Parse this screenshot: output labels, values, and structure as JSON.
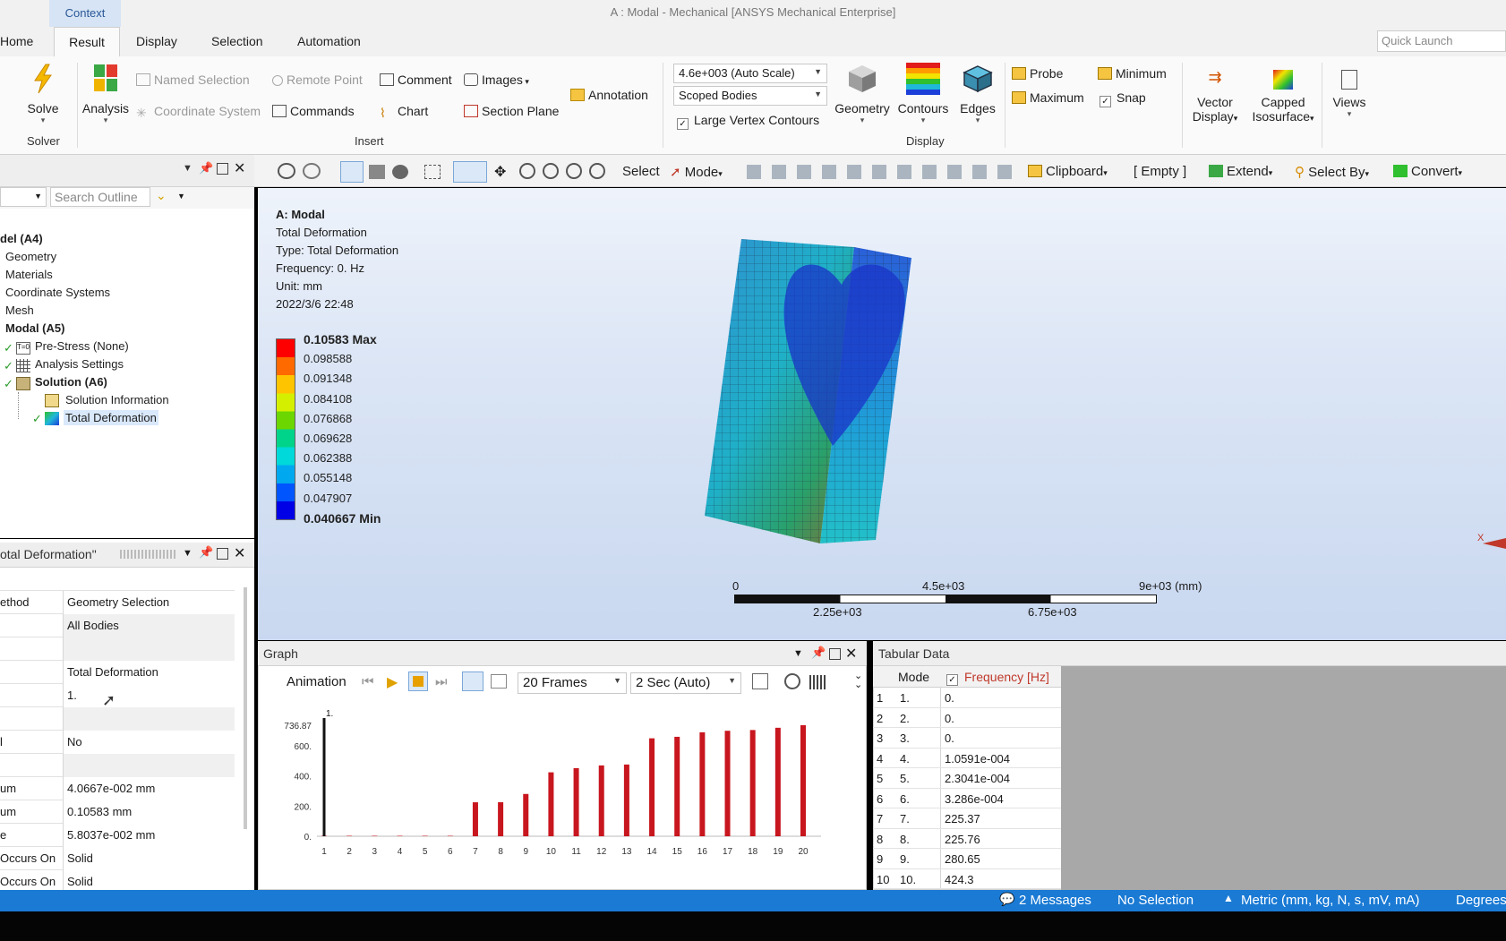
{
  "window": {
    "title": "A : Modal - Mechanical [ANSYS Mechanical Enterprise]",
    "context_tab": "Context",
    "quick_launch_placeholder": "Quick Launch"
  },
  "ribbon_tabs": [
    "Home",
    "Result",
    "Display",
    "Selection",
    "Automation"
  ],
  "ribbon": {
    "solve": "Solve",
    "solver_group": "Solver",
    "analysis": "Analysis",
    "named_selection": "Named Selection",
    "remote_point": "Remote Point",
    "comment": "Comment",
    "images": "Images",
    "coordinate_system": "Coordinate System",
    "commands": "Commands",
    "chart": "Chart",
    "section_plane": "Section Plane",
    "annotation": "Annotation",
    "insert_group": "Insert",
    "scale_combo": "4.6e+003 (Auto Scale)",
    "scope_combo": "Scoped Bodies",
    "large_vertex_contours": "Large Vertex Contours",
    "geometry": "Geometry",
    "contours": "Contours",
    "edges": "Edges",
    "display_group": "Display",
    "probe": "Probe",
    "minimum": "Minimum",
    "maximum": "Maximum",
    "snap": "Snap",
    "vector_display_1": "Vector",
    "vector_display_2": "Display",
    "capped_iso_1": "Capped",
    "capped_iso_2": "Isosurface",
    "views": "Views"
  },
  "toolbar": {
    "select": "Select",
    "mode": "Mode",
    "clipboard": "Clipboard",
    "empty": "[ Empty ]",
    "extend": "Extend",
    "select_by": "Select By",
    "convert": "Convert"
  },
  "outline": {
    "search_placeholder": "Search Outline",
    "items": [
      "del (A4)",
      "Geometry",
      "Materials",
      "Coordinate Systems",
      "Mesh",
      "Modal (A5)",
      "Pre-Stress (None)",
      "Analysis Settings",
      "Solution (A6)",
      "Solution Information",
      "Total Deformation"
    ]
  },
  "details": {
    "header": "otal Deformation\"",
    "rows": [
      {
        "k": "ethod",
        "v": "Geometry Selection"
      },
      {
        "k": "",
        "v": "All Bodies"
      },
      {
        "k": "",
        "v": ""
      },
      {
        "k": "",
        "v": "Total Deformation"
      },
      {
        "k": "",
        "v": "1."
      },
      {
        "k": "",
        "v": ""
      },
      {
        "k": "l",
        "v": "No"
      },
      {
        "k": "",
        "v": ""
      },
      {
        "k": "um",
        "v": "4.0667e-002 mm"
      },
      {
        "k": "um",
        "v": "0.10583 mm"
      },
      {
        "k": "e",
        "v": "5.8037e-002 mm"
      },
      {
        "k": "Occurs On",
        "v": "Solid"
      },
      {
        "k": "Occurs On",
        "v": "Solid"
      }
    ]
  },
  "viewport": {
    "info": [
      "A: Modal",
      "Total Deformation",
      "Type: Total Deformation",
      "Frequency: 0. Hz",
      "Unit: mm",
      "2022/3/6 22:48"
    ],
    "legend": [
      "0.10583 Max",
      "0.098588",
      "0.091348",
      "0.084108",
      "0.076868",
      "0.069628",
      "0.062388",
      "0.055148",
      "0.047907",
      "0.040667 Min"
    ],
    "legend_colors": [
      "#ff0000",
      "#ff6a00",
      "#ffc400",
      "#d4f000",
      "#6bd600",
      "#00d48a",
      "#00d9d9",
      "#00a8f0",
      "#0055ff",
      "#0000e6"
    ],
    "scale": {
      "t0": "0",
      "t1": "4.5e+03",
      "t2": "9e+03 (mm)",
      "b1": "2.25e+03",
      "b2": "6.75e+03"
    },
    "axis_x": "X"
  },
  "graph": {
    "title": "Graph",
    "animation": "Animation",
    "frames": "20 Frames",
    "duration": "2 Sec (Auto)"
  },
  "chart_data": {
    "type": "bar",
    "title": "",
    "categories": [
      "1",
      "2",
      "3",
      "4",
      "5",
      "6",
      "7",
      "8",
      "9",
      "10",
      "11",
      "12",
      "13",
      "14",
      "15",
      "16",
      "17",
      "18",
      "19",
      "20"
    ],
    "values": [
      0,
      0,
      0,
      0.00010591,
      0.00023041,
      0.0003286,
      225.37,
      225.76,
      280.65,
      424.3,
      452,
      470,
      476,
      650,
      660,
      690,
      700,
      705,
      720,
      736.87
    ],
    "highlight_label": "1.",
    "y_ticks": [
      "736.87",
      "600.",
      "400.",
      "200.",
      "0."
    ],
    "ylim": [
      0,
      736.87
    ]
  },
  "tabular": {
    "title": "Tabular Data",
    "col_mode": "Mode",
    "col_freq": "Frequency [Hz]",
    "rows": [
      [
        "1",
        "1.",
        "0."
      ],
      [
        "2",
        "2.",
        "0."
      ],
      [
        "3",
        "3.",
        "0."
      ],
      [
        "4",
        "4.",
        "1.0591e-004"
      ],
      [
        "5",
        "5.",
        "2.3041e-004"
      ],
      [
        "6",
        "6.",
        "3.286e-004"
      ],
      [
        "7",
        "7.",
        "225.37"
      ],
      [
        "8",
        "8.",
        "225.76"
      ],
      [
        "9",
        "9.",
        "280.65"
      ],
      [
        "10",
        "10.",
        "424.3"
      ]
    ]
  },
  "status": {
    "messages": "2 Messages",
    "selection": "No Selection",
    "units": "Metric (mm, kg, N, s, mV, mA)",
    "angle": "Degrees"
  },
  "colors": {
    "status_bar": "#1a7ad4",
    "bar_red": "#c8161e",
    "freq_header": "#c0392b"
  }
}
